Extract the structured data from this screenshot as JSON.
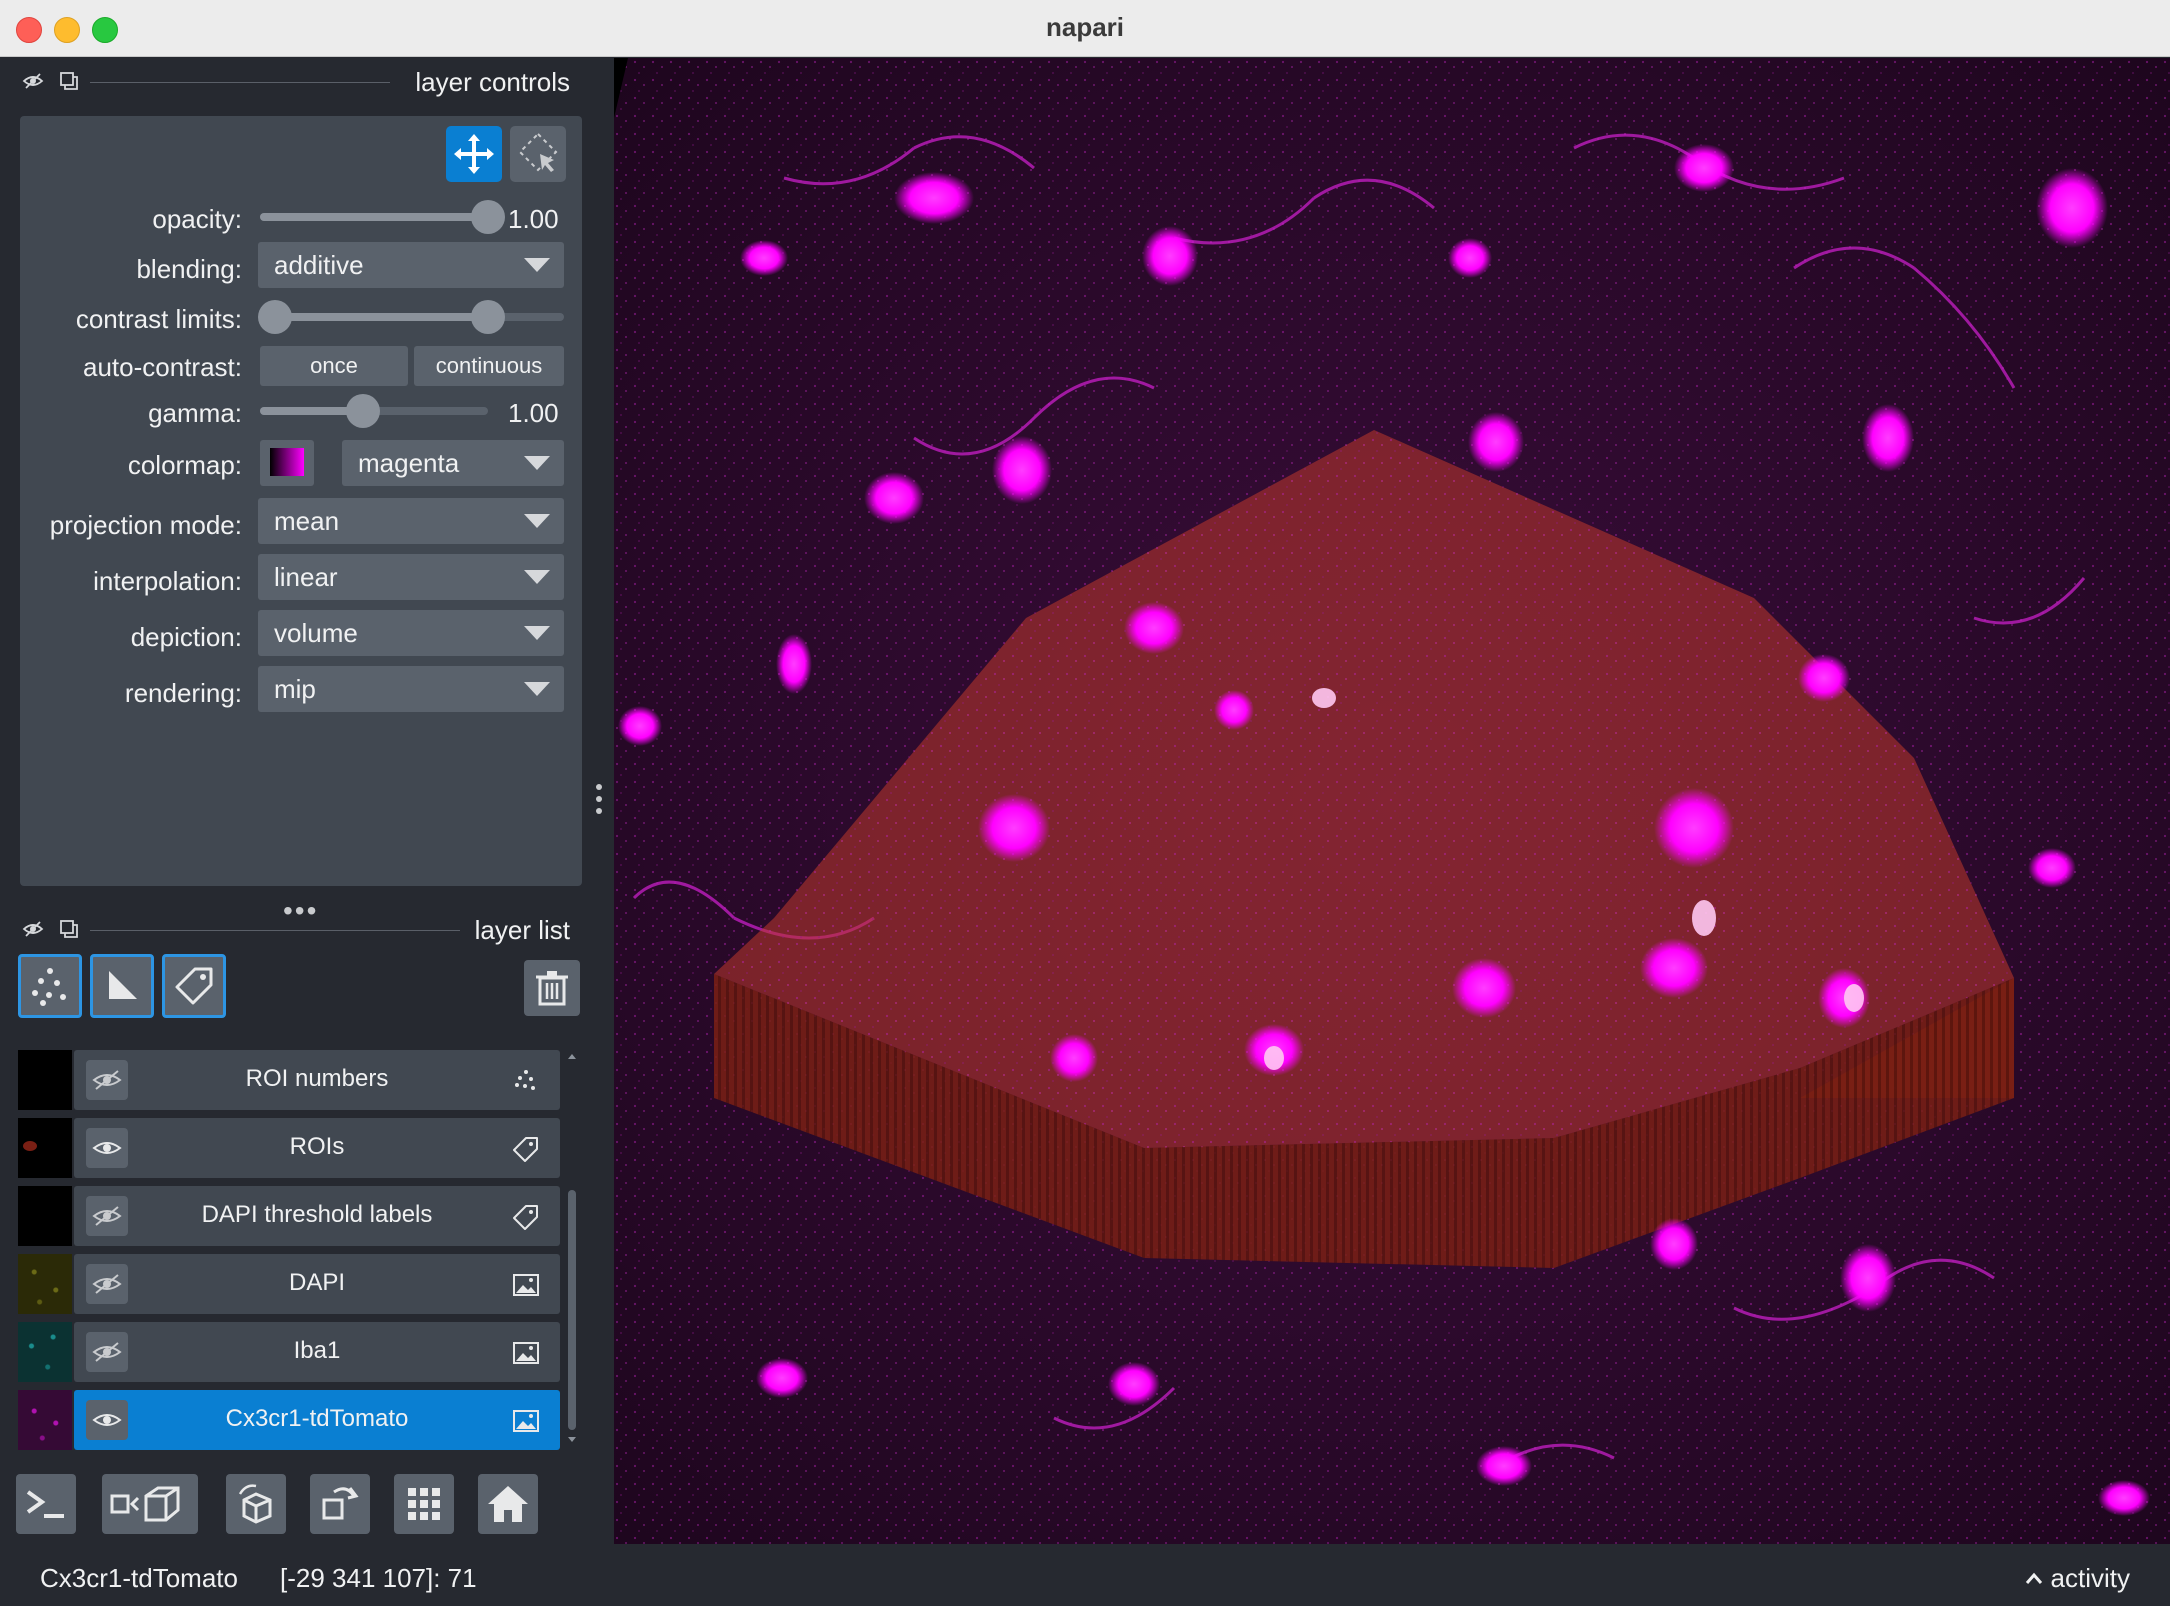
{
  "window": {
    "title": "napari"
  },
  "layer_controls": {
    "title": "layer controls",
    "opacity": {
      "label": "opacity:",
      "value": "1.00",
      "level": 1.0
    },
    "blending": {
      "label": "blending:",
      "value": "additive"
    },
    "contrast_limits": {
      "label": "contrast limits:",
      "low": 0.0,
      "high": 0.75
    },
    "auto_contrast": {
      "label": "auto-contrast:",
      "once": "once",
      "continuous": "continuous"
    },
    "gamma": {
      "label": "gamma:",
      "value": "1.00",
      "level": 0.45
    },
    "colormap": {
      "label": "colormap:",
      "value": "magenta"
    },
    "projection_mode": {
      "label": "projection mode:",
      "value": "mean"
    },
    "interpolation": {
      "label": "interpolation:",
      "value": "linear"
    },
    "depiction": {
      "label": "depiction:",
      "value": "volume"
    },
    "rendering": {
      "label": "rendering:",
      "value": "mip"
    }
  },
  "layer_list": {
    "title": "layer list",
    "layers": [
      {
        "name": "ROI numbers",
        "type_icon": "points-icon",
        "visible": false,
        "selected": false
      },
      {
        "name": "ROIs",
        "type_icon": "labels-icon",
        "visible": true,
        "selected": false
      },
      {
        "name": "DAPI threshold labels",
        "type_icon": "labels-icon",
        "visible": false,
        "selected": false
      },
      {
        "name": "DAPI",
        "type_icon": "image-icon",
        "visible": false,
        "selected": false
      },
      {
        "name": "Iba1",
        "type_icon": "image-icon",
        "visible": false,
        "selected": false
      },
      {
        "name": "Cx3cr1-tdTomato",
        "type_icon": "image-icon",
        "visible": true,
        "selected": true
      }
    ]
  },
  "status_bar": {
    "layer": "Cx3cr1-tdTomato",
    "coords": "[-29 341 107]: 71",
    "activity": "activity"
  },
  "colors": {
    "accent": "#0a7fd2",
    "panel": "#414851",
    "background": "#262930",
    "roi_overlay": "#c0392b",
    "signal": "#ff00ff"
  }
}
